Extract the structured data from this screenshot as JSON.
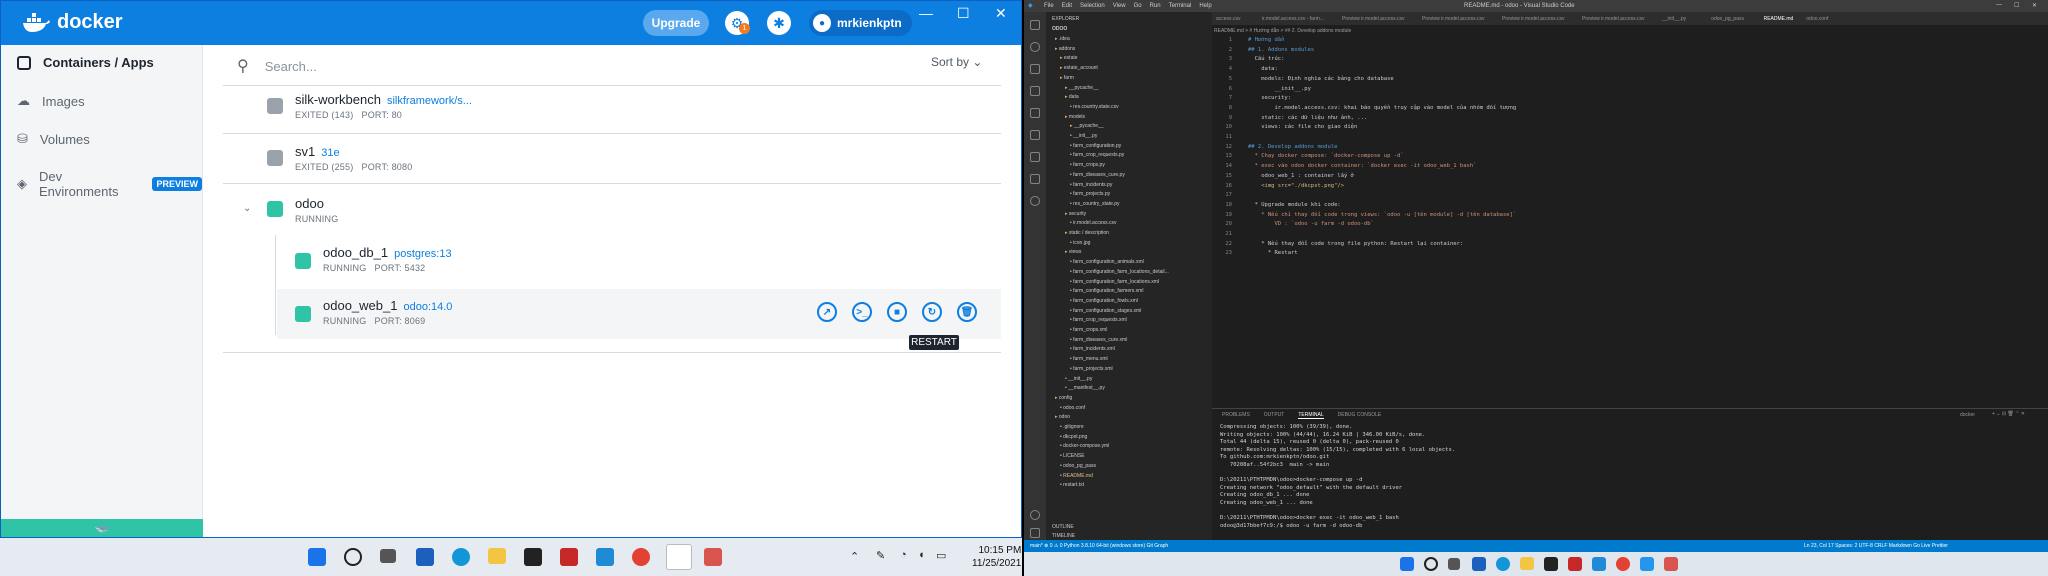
{
  "docker": {
    "title": "docker",
    "upgrade": "Upgrade",
    "badge": "1",
    "username": "mrkienkptn",
    "sidebar": [
      {
        "label": "Containers / Apps"
      },
      {
        "label": "Images"
      },
      {
        "label": "Volumes"
      },
      {
        "label": "Dev Environments"
      }
    ],
    "preview_badge": "PREVIEW",
    "search_placeholder": "Search...",
    "sort_by": "Sort by",
    "containers": [
      {
        "name": "silk-workbench",
        "image": "silkframework/s...",
        "status": "EXITED (143)",
        "port": "PORT: 80"
      },
      {
        "name": "sv1",
        "image": "31e",
        "status": "EXITED (255)",
        "port": "PORT: 8080"
      },
      {
        "name": "odoo",
        "status": "RUNNING"
      },
      {
        "name": "odoo_db_1",
        "image": "postgres:13",
        "status": "RUNNING",
        "port": "PORT: 5432"
      },
      {
        "name": "odoo_web_1",
        "image": "odoo:14.0",
        "status": "RUNNING",
        "port": "PORT: 8069"
      }
    ],
    "tooltip": "RESTART"
  },
  "vscode": {
    "title": "README.md - odoo - Visual Studio Code",
    "menu": [
      "File",
      "Edit",
      "Selection",
      "View",
      "Go",
      "Run",
      "Terminal",
      "Help"
    ],
    "explorer_title": "EXPLORER",
    "root": "ODOO",
    "tree": [
      ".idea",
      "addons",
      "estate",
      "estate_account",
      "farm",
      "__pycache__",
      "data",
      "res.country.state.csv",
      "models",
      "__pycache__",
      "__init__.py",
      "farm_configuration.py",
      "farm_crop_requests.py",
      "farm_crops.py",
      "farm_diseases_cure.py",
      "farm_incidents.py",
      "farm_projects.py",
      "res_country_state.py",
      "security",
      "ir.model.access.csv",
      "static / description",
      "icon.jpg",
      "views",
      "farm_configuration_animals.xml",
      "farm_configuration_farm_locations_detail...",
      "farm_configuration_farm_locations.xml",
      "farm_configuration_farmers.xml",
      "farm_configuration_fowls.xml",
      "farm_configuration_stages.xml",
      "farm_crop_requests.xml",
      "farm_crops.xml",
      "farm_diseases_cure.xml",
      "farm_incidents.xml",
      "farm_menu.xml",
      "farm_projects.xml",
      "__init__.py",
      "__manifest__.py",
      "config",
      "odoo.conf",
      "odoo",
      ".gitignore",
      "dkcpst.png",
      "docker-compose.yml",
      "LICENSE",
      "odoo_pg_pass",
      "README.md",
      "restart.txt"
    ],
    "outline": "OUTLINE",
    "timeline": "TIMELINE",
    "tabs": [
      "access.csv",
      "ir.model.access.csv - farm...",
      "Preview ir.model.access.csv",
      "Preview ir.model.access.csv",
      "Preview ir.model.access.csv",
      "Preview ir.model.access.csv",
      "__init__.py",
      "odoo_pg_pass",
      "README.md",
      "odoo.conf"
    ],
    "breadcrumb": "README.md > # Hướng dẫn > ## 2. Develop addons module",
    "code": [
      "# Hướng dẫn",
      "## 1. Addons modules",
      "  Cấu trúc:",
      "    data:",
      "    models: Định nghĩa các bảng cho database",
      "        __init__.py",
      "    security:",
      "        ir.model.access.csv: khai báo quyền truy cập vào model của nhóm đối tượng",
      "    static: các dữ liệu như ảnh, ...",
      "    views: các file cho giao diện",
      "",
      "## 2. Develop addons module",
      "  * Chạy docker compose: `docker-compose up -d`",
      "  * exec vào odoo docker container: `docker exec -it odoo_web_1 bash`",
      "    odoo_web_1 : container lấy ở",
      "    <img src=\"./dkcpst.png\"/>",
      "",
      "  * Upgrade module khi code:",
      "    * Nếu chỉ thay đổi code trong views: `odoo -u [tên module] -d [tên database]`",
      "        VD : `odoo -u farm -d odoo-db`",
      "",
      "    * Nếu thay đổi code trong file python: Restart lại container:",
      "      * Restart"
    ],
    "panel_tabs": [
      "PROBLEMS",
      "OUTPUT",
      "TERMINAL",
      "DEBUG CONSOLE"
    ],
    "terminal_label": "docker",
    "terminal": [
      "Compressing objects: 100% (39/39), done.",
      "Writing objects: 100% (44/44), 16.24 KiB | 346.00 KiB/s, done.",
      "Total 44 (delta 15), reused 0 (delta 0), pack-reused 0",
      "remote: Resolving deltas: 100% (15/15), completed with 6 local objects.",
      "To github.com:mrkienkptn/odoo.git",
      "   70208af..54f2bc3  main -> main",
      "",
      "D:\\20211\\PTHTPMDN\\odoo>docker-compose up -d",
      "Creating network \"odoo_default\" with the default driver",
      "Creating odoo_db_1 ... done",
      "Creating odoo_web_1 ... done",
      "",
      "D:\\20211\\PTHTPMDN\\odoo>docker exec -it odoo_web_1 bash",
      "odoo@3d17bbef7c9:/$ odoo -u farm -d odoo-db"
    ],
    "status_left": "main*  ⊗ 0 ⚠ 0   Python 3.8.10 64-bit (windows store)   Git Graph",
    "status_right": "Ln 23, Col 17   Spaces: 2   UTF-8   CRLF   Markdown   Go Live   Prettier"
  },
  "taskbar": {
    "time": "10:15 PM",
    "date": "11/25/2021"
  }
}
